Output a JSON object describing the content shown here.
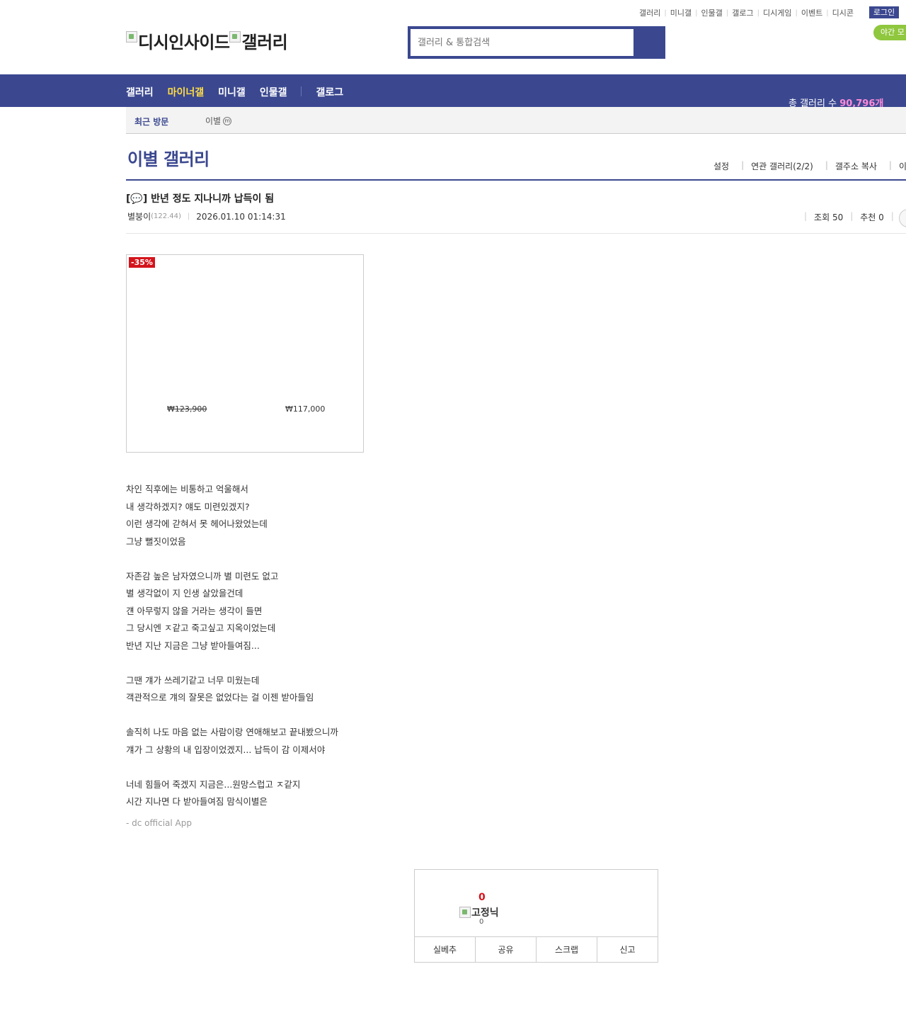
{
  "top_links": [
    "갤러리",
    "미니갤",
    "인물갤",
    "갤로그",
    "디시게임",
    "이벤트",
    "디시콘"
  ],
  "login_label": "로그인",
  "night_label": "야간 모",
  "logo": {
    "site": "디시인사이드",
    "gallery": "갤러리"
  },
  "search": {
    "placeholder": "갤러리 & 통합검색"
  },
  "nav": {
    "items": [
      "갤러리",
      "마이너갤",
      "미니갤",
      "인물갤",
      "갤로그"
    ],
    "active": "마이너갤"
  },
  "total_galleries": {
    "label": "총 갤러리 수",
    "value": "90,796개"
  },
  "recent": {
    "label": "최근 방문",
    "gallery": "이별",
    "badge": "m"
  },
  "gallery": {
    "title": "이별 갤러리",
    "menu": [
      "설정",
      "연관 갤러리(2/2)",
      "갤주소 복사",
      "이용"
    ]
  },
  "post": {
    "title": "[💬] 반년 정도 지나니까 납득이 됨",
    "author": "별붕이",
    "ip": "(122.44)",
    "datetime": "2026.01.10 01:14:31",
    "views_label": "조회 50",
    "recommend_label": "추천 0"
  },
  "ad": {
    "discount": "-35%",
    "old_price": "₩123,900",
    "new_price": "₩117,000"
  },
  "content_lines": [
    "차인 직후에는 비통하고 억울해서",
    "내 생각하겠지? 얘도 미련있겠지?",
    "이런 생각에 갇혀서 못 헤어나왔었는데",
    "그냥 뻘짓이었음",
    "",
    "자존감 높은 남자였으니까 별 미련도 없고",
    "별 생각없이 지 인생 살았을건데",
    "걘 아무렇지 않을 거라는 생각이 들면",
    "그 당시엔 ㅈ같고 죽고싶고 지옥이었는데",
    "반년 지난 지금은 그냥 받아들여짐...",
    "",
    "그땐 걔가 쓰레기같고 너무 미웠는데",
    "객관적으로 걔의 잘못은 없었다는 걸 이젠 받아들임",
    "",
    "솔직히 나도 마음 없는 사람이랑 연애해보고 끝내봤으니까",
    "걔가 그 상황의 내 입장이었겠지... 납득이 감 이제서야",
    "",
    "너네 힘들어 죽겠지 지금은...원망스럽고 ㅈ같지",
    "시간 지나면 다 받아들여짐 맘식이별은"
  ],
  "app_signature": "- dc official App",
  "recommend_box": {
    "count": "0",
    "nick": "고정닉",
    "nick_count": "0",
    "actions": [
      "실베추",
      "공유",
      "스크랩",
      "신고"
    ]
  }
}
